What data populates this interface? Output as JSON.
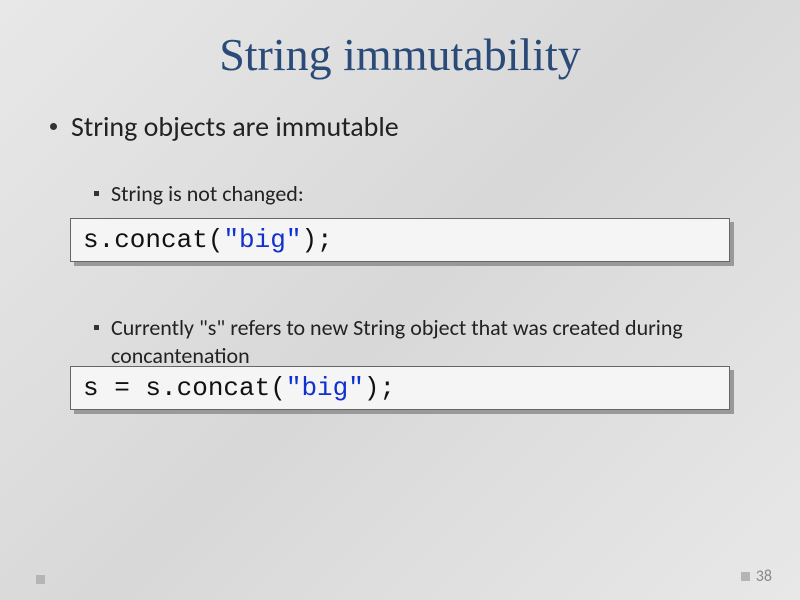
{
  "slide": {
    "title": "String immutability",
    "bullet1": "String objects are immutable",
    "bullet2": "String is not changed:",
    "bullet3": "Currently \"s\" refers to new String object that was created during concantenation",
    "page_number": "38"
  },
  "code1": {
    "pre": "s.concat(",
    "str": "\"big\"",
    "post": ");"
  },
  "code2": {
    "pre": "s = s.concat(",
    "str": "\"big\"",
    "post": ");"
  }
}
